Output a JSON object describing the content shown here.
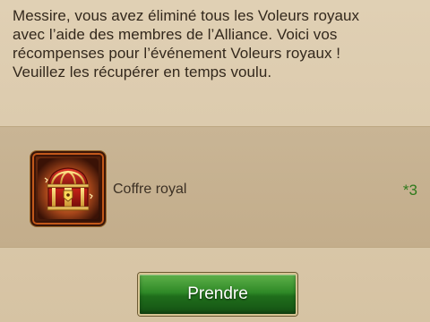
{
  "message": {
    "lines": [
      "Messire, vous avez éliminé tous les Voleurs royaux",
      "avec l’aide des membres de l’Alliance. Voici vos",
      "récompenses pour l’événement Voleurs royaux !",
      "Veuillez les récupérer en temps voulu."
    ]
  },
  "reward": {
    "icon": "treasure-chest-icon",
    "name": "Coffre royal",
    "count": "*3"
  },
  "action": {
    "take_label": "Prendre"
  },
  "colors": {
    "background": "#dccbae",
    "panel": "#c6b190",
    "count_green": "#2f7a1c",
    "button_green": "#2f8a27"
  }
}
